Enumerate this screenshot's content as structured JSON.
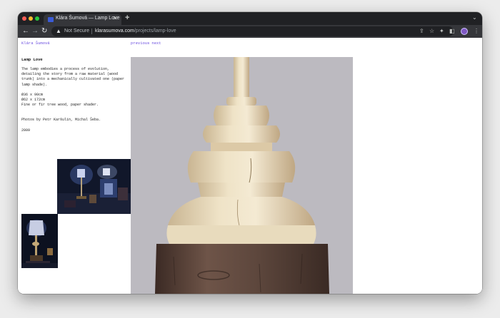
{
  "browser": {
    "tab": {
      "title": "Klára Šumová — Lamp Love",
      "favicon": "square-favicon-icon"
    },
    "new_tab_symbol": "+",
    "address": {
      "security_label": "Not Secure",
      "host": "klarasumova.com",
      "path": "/projects/lamp-love"
    },
    "colors": {
      "tabbar": "#202124",
      "toolbar": "#35363a",
      "omnibox": "#202124"
    }
  },
  "page": {
    "site_name": "Klára Šumová",
    "nav": {
      "previous": "previous",
      "next": "next"
    },
    "project": {
      "title": "Lamp Love",
      "description": "The lamp embodies a process of evolution, detailing the story from a raw material (wood trunk) into a mechanically cultivated one (paper lamp shade).",
      "dimensions": [
        "Ø36 x 90cm",
        "Ø62 x 172cm"
      ],
      "materials": "Fine or fir tree wood, paper shader.",
      "credits": "Photos by Petr Karšulín, Michal Šeba.",
      "year": "2009"
    },
    "colors": {
      "link": "#6c4fe0",
      "text": "#222222",
      "background": "#ffffff"
    }
  }
}
